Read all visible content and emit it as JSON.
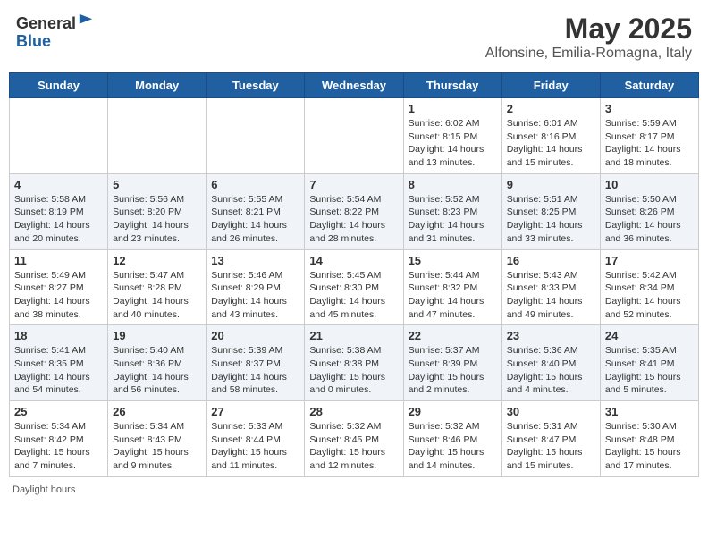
{
  "header": {
    "logo_line1": "General",
    "logo_line2": "Blue",
    "month": "May 2025",
    "location": "Alfonsine, Emilia-Romagna, Italy"
  },
  "days_of_week": [
    "Sunday",
    "Monday",
    "Tuesday",
    "Wednesday",
    "Thursday",
    "Friday",
    "Saturday"
  ],
  "weeks": [
    [
      {
        "day": "",
        "sunrise": "",
        "sunset": "",
        "daylight": ""
      },
      {
        "day": "",
        "sunrise": "",
        "sunset": "",
        "daylight": ""
      },
      {
        "day": "",
        "sunrise": "",
        "sunset": "",
        "daylight": ""
      },
      {
        "day": "",
        "sunrise": "",
        "sunset": "",
        "daylight": ""
      },
      {
        "day": "1",
        "sunrise": "Sunrise: 6:02 AM",
        "sunset": "Sunset: 8:15 PM",
        "daylight": "Daylight: 14 hours and 13 minutes."
      },
      {
        "day": "2",
        "sunrise": "Sunrise: 6:01 AM",
        "sunset": "Sunset: 8:16 PM",
        "daylight": "Daylight: 14 hours and 15 minutes."
      },
      {
        "day": "3",
        "sunrise": "Sunrise: 5:59 AM",
        "sunset": "Sunset: 8:17 PM",
        "daylight": "Daylight: 14 hours and 18 minutes."
      }
    ],
    [
      {
        "day": "4",
        "sunrise": "Sunrise: 5:58 AM",
        "sunset": "Sunset: 8:19 PM",
        "daylight": "Daylight: 14 hours and 20 minutes."
      },
      {
        "day": "5",
        "sunrise": "Sunrise: 5:56 AM",
        "sunset": "Sunset: 8:20 PM",
        "daylight": "Daylight: 14 hours and 23 minutes."
      },
      {
        "day": "6",
        "sunrise": "Sunrise: 5:55 AM",
        "sunset": "Sunset: 8:21 PM",
        "daylight": "Daylight: 14 hours and 26 minutes."
      },
      {
        "day": "7",
        "sunrise": "Sunrise: 5:54 AM",
        "sunset": "Sunset: 8:22 PM",
        "daylight": "Daylight: 14 hours and 28 minutes."
      },
      {
        "day": "8",
        "sunrise": "Sunrise: 5:52 AM",
        "sunset": "Sunset: 8:23 PM",
        "daylight": "Daylight: 14 hours and 31 minutes."
      },
      {
        "day": "9",
        "sunrise": "Sunrise: 5:51 AM",
        "sunset": "Sunset: 8:25 PM",
        "daylight": "Daylight: 14 hours and 33 minutes."
      },
      {
        "day": "10",
        "sunrise": "Sunrise: 5:50 AM",
        "sunset": "Sunset: 8:26 PM",
        "daylight": "Daylight: 14 hours and 36 minutes."
      }
    ],
    [
      {
        "day": "11",
        "sunrise": "Sunrise: 5:49 AM",
        "sunset": "Sunset: 8:27 PM",
        "daylight": "Daylight: 14 hours and 38 minutes."
      },
      {
        "day": "12",
        "sunrise": "Sunrise: 5:47 AM",
        "sunset": "Sunset: 8:28 PM",
        "daylight": "Daylight: 14 hours and 40 minutes."
      },
      {
        "day": "13",
        "sunrise": "Sunrise: 5:46 AM",
        "sunset": "Sunset: 8:29 PM",
        "daylight": "Daylight: 14 hours and 43 minutes."
      },
      {
        "day": "14",
        "sunrise": "Sunrise: 5:45 AM",
        "sunset": "Sunset: 8:30 PM",
        "daylight": "Daylight: 14 hours and 45 minutes."
      },
      {
        "day": "15",
        "sunrise": "Sunrise: 5:44 AM",
        "sunset": "Sunset: 8:32 PM",
        "daylight": "Daylight: 14 hours and 47 minutes."
      },
      {
        "day": "16",
        "sunrise": "Sunrise: 5:43 AM",
        "sunset": "Sunset: 8:33 PM",
        "daylight": "Daylight: 14 hours and 49 minutes."
      },
      {
        "day": "17",
        "sunrise": "Sunrise: 5:42 AM",
        "sunset": "Sunset: 8:34 PM",
        "daylight": "Daylight: 14 hours and 52 minutes."
      }
    ],
    [
      {
        "day": "18",
        "sunrise": "Sunrise: 5:41 AM",
        "sunset": "Sunset: 8:35 PM",
        "daylight": "Daylight: 14 hours and 54 minutes."
      },
      {
        "day": "19",
        "sunrise": "Sunrise: 5:40 AM",
        "sunset": "Sunset: 8:36 PM",
        "daylight": "Daylight: 14 hours and 56 minutes."
      },
      {
        "day": "20",
        "sunrise": "Sunrise: 5:39 AM",
        "sunset": "Sunset: 8:37 PM",
        "daylight": "Daylight: 14 hours and 58 minutes."
      },
      {
        "day": "21",
        "sunrise": "Sunrise: 5:38 AM",
        "sunset": "Sunset: 8:38 PM",
        "daylight": "Daylight: 15 hours and 0 minutes."
      },
      {
        "day": "22",
        "sunrise": "Sunrise: 5:37 AM",
        "sunset": "Sunset: 8:39 PM",
        "daylight": "Daylight: 15 hours and 2 minutes."
      },
      {
        "day": "23",
        "sunrise": "Sunrise: 5:36 AM",
        "sunset": "Sunset: 8:40 PM",
        "daylight": "Daylight: 15 hours and 4 minutes."
      },
      {
        "day": "24",
        "sunrise": "Sunrise: 5:35 AM",
        "sunset": "Sunset: 8:41 PM",
        "daylight": "Daylight: 15 hours and 5 minutes."
      }
    ],
    [
      {
        "day": "25",
        "sunrise": "Sunrise: 5:34 AM",
        "sunset": "Sunset: 8:42 PM",
        "daylight": "Daylight: 15 hours and 7 minutes."
      },
      {
        "day": "26",
        "sunrise": "Sunrise: 5:34 AM",
        "sunset": "Sunset: 8:43 PM",
        "daylight": "Daylight: 15 hours and 9 minutes."
      },
      {
        "day": "27",
        "sunrise": "Sunrise: 5:33 AM",
        "sunset": "Sunset: 8:44 PM",
        "daylight": "Daylight: 15 hours and 11 minutes."
      },
      {
        "day": "28",
        "sunrise": "Sunrise: 5:32 AM",
        "sunset": "Sunset: 8:45 PM",
        "daylight": "Daylight: 15 hours and 12 minutes."
      },
      {
        "day": "29",
        "sunrise": "Sunrise: 5:32 AM",
        "sunset": "Sunset: 8:46 PM",
        "daylight": "Daylight: 15 hours and 14 minutes."
      },
      {
        "day": "30",
        "sunrise": "Sunrise: 5:31 AM",
        "sunset": "Sunset: 8:47 PM",
        "daylight": "Daylight: 15 hours and 15 minutes."
      },
      {
        "day": "31",
        "sunrise": "Sunrise: 5:30 AM",
        "sunset": "Sunset: 8:48 PM",
        "daylight": "Daylight: 15 hours and 17 minutes."
      }
    ]
  ],
  "footer": {
    "note": "Daylight hours"
  }
}
